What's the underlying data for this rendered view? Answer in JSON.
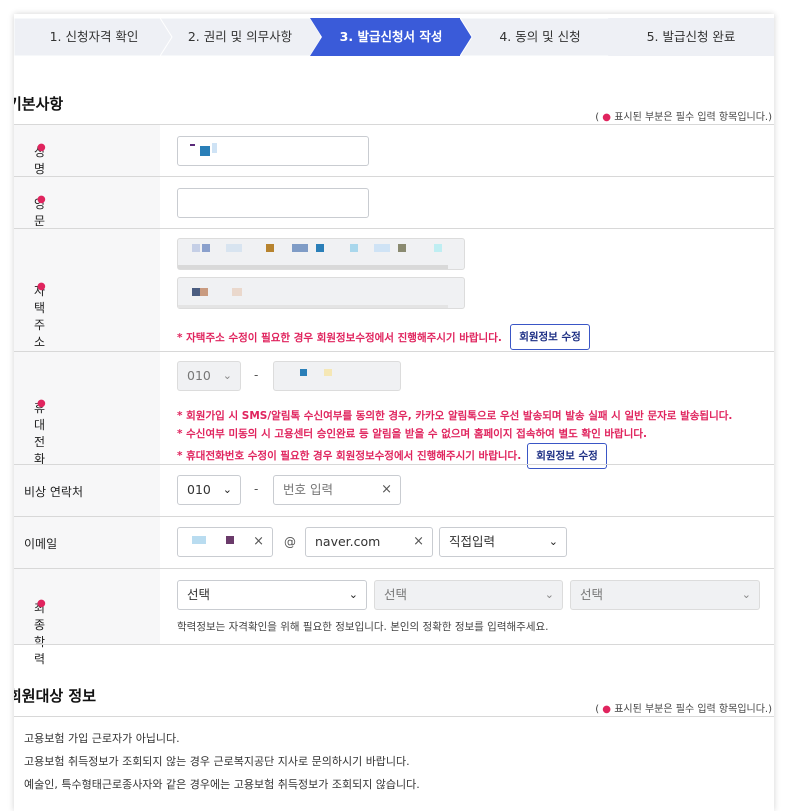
{
  "steps": [
    {
      "label": "1. 신청자격 확인",
      "active": false
    },
    {
      "label": "2. 권리 및 의무사항",
      "active": false
    },
    {
      "label": "3. 발급신청서 작성",
      "active": true
    },
    {
      "label": "4. 동의 및 신청",
      "active": false
    },
    {
      "label": "5. 발급신청 완료",
      "active": false
    }
  ],
  "colors": {
    "active_step": "#3a5bd9",
    "inactive_step": "#eef0f5",
    "required": "#e0245e",
    "button_border": "#3a56c6"
  },
  "section_basic": {
    "title": "기본사항",
    "required_note_prefix": "(",
    "required_note_dot": "●",
    "required_note_text": "표시된 부분은 필수 입력 항목입니다.)"
  },
  "form": {
    "name": {
      "label": "성명"
    },
    "eng_name": {
      "label": "영문성명",
      "value": ""
    },
    "address": {
      "label": "자택 주소",
      "notice": "* 자택주소 수정이 필요한 경우 회원정보수정에서 진행해주시기 바랍니다.",
      "button": "회원정보 수정"
    },
    "mobile": {
      "label": "휴대전화",
      "prefix": "010",
      "dash": "-",
      "notices": [
        "* 회원가입 시 SMS/알림톡 수신여부를 동의한 경우, 카카오 알림톡으로 우선 발송되며 발송 실패 시 일반 문자로 발송됩니다.",
        "* 수신여부 미동의 시 고용센터 승인완료 등 알림을 받을 수 없으며 홈페이지 접속하여 별도 확인 바랍니다.",
        "* 휴대전화번호 수정이 필요한 경우 회원정보수정에서 진행해주시기 바랍니다."
      ],
      "button": "회원정보 수정"
    },
    "emergency": {
      "label": "비상 연락처",
      "prefix": "010",
      "dash": "-",
      "placeholder": "번호 입력",
      "clear": "×"
    },
    "email": {
      "label": "이메일",
      "at": "@",
      "domain": "naver.com",
      "clear": "×",
      "domain_select": "직접입력"
    },
    "education": {
      "label": "최종학력",
      "selects": [
        "선택",
        "선택",
        "선택"
      ],
      "help": "학력정보는 자격확인을 위해 필요한 정보입니다. 본인의 정확한 정보를 입력해주세요."
    },
    "required_star": "●"
  },
  "section_member": {
    "title": "회원대상 정보",
    "required_note_prefix": "(",
    "required_note_dot": "●",
    "required_note_text": "표시된 부분은 필수 입력 항목입니다.)",
    "lines": [
      "고용보험 가입 근로자가 아닙니다.",
      "고용보험 취득정보가 조회되지 않는 경우 근로복지공단 지사로 문의하시기 바랍니다.",
      "예술인, 특수형태근로종사자와 같은 경우에는 고용보험 취득정보가 조회되지 않습니다."
    ]
  }
}
